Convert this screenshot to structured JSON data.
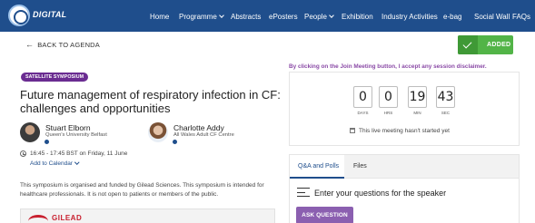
{
  "header": {
    "logo_text": "DIGITAL",
    "nav": [
      {
        "label": "Home",
        "dropdown": false
      },
      {
        "label": "Programme",
        "dropdown": true
      },
      {
        "label": "Abstracts",
        "dropdown": false
      },
      {
        "label": "ePosters",
        "dropdown": false
      },
      {
        "label": "People",
        "dropdown": true
      },
      {
        "label": "Exhibition",
        "dropdown": false
      },
      {
        "label": "Industry Activities",
        "dropdown": false
      },
      {
        "label": "e-bag",
        "dropdown": false
      },
      {
        "label": "Social Wall",
        "dropdown": false
      },
      {
        "label": "FAQs",
        "dropdown": false
      }
    ]
  },
  "back_link": "BACK TO AGENDA",
  "added_button": "ADDED",
  "session": {
    "badge": "SATELLITE SYMPOSIUM",
    "title": "Future management of respiratory infection in CF: challenges and opportunities",
    "speakers": [
      {
        "name": "Stuart Elborn",
        "affiliation": "Queen's University Belfast"
      },
      {
        "name": "Charlotte Addy",
        "affiliation": "All Wales Adult CF Centre"
      }
    ],
    "time": "16:45 - 17:45 BST on Friday, 11 June",
    "add_to_calendar": "Add to Calendar",
    "description": "This symposium is organised and funded by Gilead Sciences. This symposium is intended for healthcare professionals. It is not open to patients or members of the public.",
    "banner_brand": "GILEAD"
  },
  "disclaimer": "By clicking on the Join Meeting button, I accept any session disclaimer.",
  "countdown": {
    "units": [
      {
        "value": "0",
        "label": "DAYS"
      },
      {
        "value": "0",
        "label": "HRS"
      },
      {
        "value": "19",
        "label": "MIN"
      },
      {
        "value": "43",
        "label": "SEC"
      }
    ],
    "status": "This live meeting hasn't started yet"
  },
  "panel": {
    "tabs": [
      "Q&A and Polls",
      "Files"
    ],
    "active_tab": "Q&A and Polls",
    "question_title": "Enter your questions for the speaker",
    "ask_button": "ASK QUESTION"
  },
  "colors": {
    "nav_bg": "#1f4e8c",
    "added_green": "#52b447",
    "purple": "#6a2c91",
    "disclaimer_purple": "#8a4aa6",
    "ask_button": "#8b5fb0"
  },
  "icons": [
    "logo-icon",
    "arrow-left-icon",
    "check-icon",
    "clock-icon",
    "calendar-icon",
    "menu-lines-icon",
    "chevron-down-icon"
  ]
}
